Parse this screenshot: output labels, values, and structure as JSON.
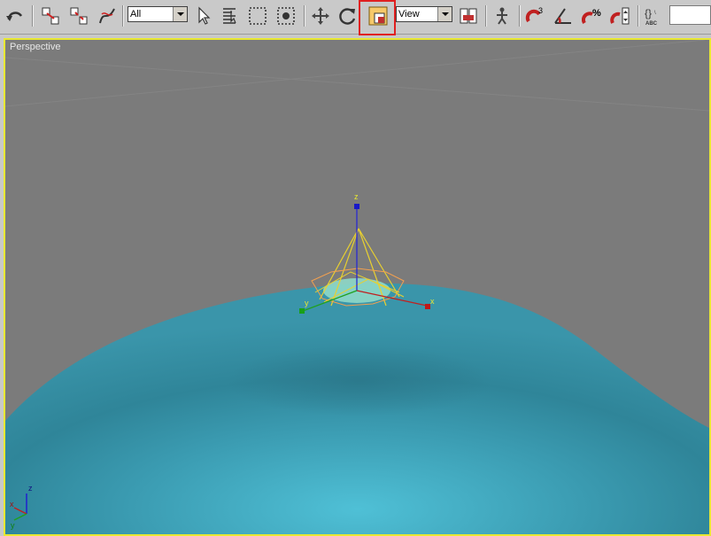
{
  "toolbar": {
    "selection_filter": "All",
    "reference_coord": "View",
    "tools": [
      "undo-icon",
      "select-link-icon",
      "unlink-icon",
      "bind-spacewarp-icon",
      "select-object-icon",
      "select-by-name-icon",
      "rectangular-selection-icon",
      "window-crossing-icon",
      "move-icon",
      "rotate-icon",
      "scale-icon",
      "pivot-center-icon",
      "manipulate-icon",
      "snap-3d-icon",
      "angle-snap-icon",
      "percent-snap-icon",
      "spinner-snap-icon",
      "named-selection-sets-icon"
    ],
    "snap_label": "3",
    "percent_label": "%",
    "named_sel_label": "ABC"
  },
  "viewport": {
    "label": "Perspective",
    "active_border_color": "#e8e832",
    "background_color": "#7b7b7b",
    "surface_color": "#3fa3b8"
  },
  "gizmo": {
    "axis_x": "x",
    "axis_y": "y",
    "axis_z": "z"
  },
  "corner_axes": {
    "x": "x",
    "y": "y",
    "z": "z"
  }
}
